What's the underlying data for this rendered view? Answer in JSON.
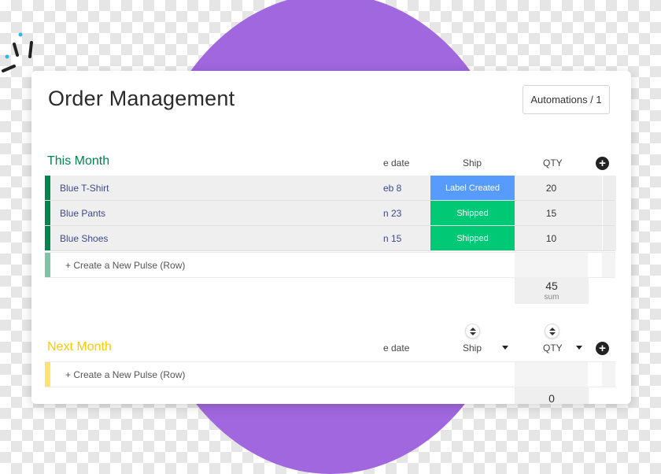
{
  "colors": {
    "this_month": "#00854d",
    "next_month": "#ffcb00",
    "label_created": "#579bfc",
    "shipped": "#00c875",
    "purple_blob": "#a167de"
  },
  "board": {
    "title": "Order Management",
    "automations_label": "Automations / 1"
  },
  "groups": [
    {
      "title": "This Month",
      "columns": {
        "date": "e date",
        "ship": "Ship",
        "qty": "QTY"
      },
      "rows": [
        {
          "name": "Blue T-Shirt",
          "date": "eb 8",
          "ship": "Label Created",
          "qty": "20"
        },
        {
          "name": "Blue Pants",
          "date": "n 23",
          "ship": "Shipped",
          "qty": "15"
        },
        {
          "name": "Blue Shoes",
          "date": "n 15",
          "ship": "Shipped",
          "qty": "10"
        }
      ],
      "create_label": "+ Create a New Pulse (Row)",
      "sum_value": "45",
      "sum_label": "sum"
    },
    {
      "title": "Next Month",
      "columns": {
        "date": "e date",
        "ship": "Ship",
        "qty": "QTY"
      },
      "rows": [],
      "create_label": "+ Create a New Pulse (Row)",
      "sum_value": "0"
    }
  ],
  "icons": {
    "add_column": "plus-circle-icon",
    "sort": "sort-icon",
    "dropdown": "caret-down-icon"
  }
}
